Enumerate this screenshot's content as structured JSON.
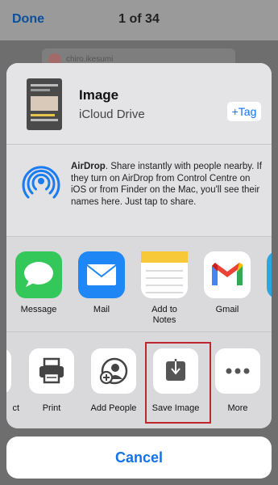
{
  "nav": {
    "done": "Done",
    "counter": "1 of 34"
  },
  "background_post": {
    "username": "chiro.ikesumi"
  },
  "header": {
    "title": "Image",
    "subtitle": "iCloud Drive",
    "tag_button": "+Tag"
  },
  "airdrop": {
    "title": "AirDrop",
    "text": ". Share instantly with people nearby. If they turn on AirDrop from Control Centre on iOS or from Finder on the Mac, you'll see their names here. Just tap to share."
  },
  "apps": [
    {
      "label": "Message",
      "icon": "messages-icon",
      "color": "#34c759"
    },
    {
      "label": "Mail",
      "icon": "mail-icon",
      "color": "#1e86f5"
    },
    {
      "label": "Add to Notes",
      "icon": "notes-icon",
      "color": "#ffffff"
    },
    {
      "label": "Gmail",
      "icon": "gmail-icon",
      "color": "#ffffff"
    }
  ],
  "actions": [
    {
      "label": "ct",
      "icon": "partial-icon"
    },
    {
      "label": "Print",
      "icon": "printer-icon"
    },
    {
      "label": "Add People",
      "icon": "add-people-icon"
    },
    {
      "label": "Save Image",
      "icon": "save-image-icon"
    },
    {
      "label": "More",
      "icon": "more-icon"
    }
  ],
  "cancel": "Cancel",
  "colors": {
    "accent": "#1172ea",
    "highlight": "#c0272d"
  }
}
